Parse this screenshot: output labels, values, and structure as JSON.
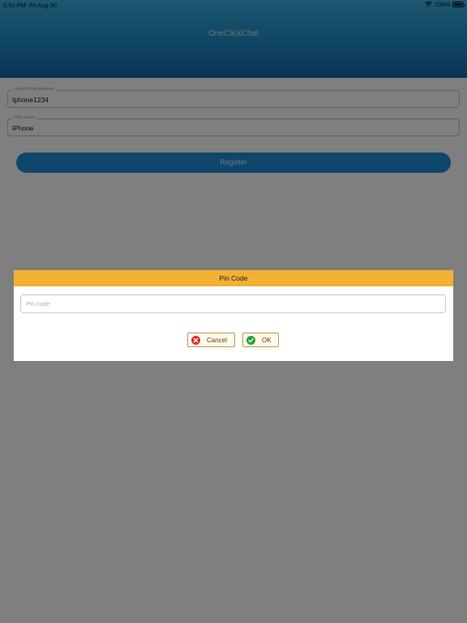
{
  "status_bar": {
    "time": "5:52 PM",
    "date": "Fri Aug 30",
    "battery": "100%",
    "icons": [
      "wifi-icon",
      "battery-icon"
    ]
  },
  "header": {
    "title": "OneClickChat"
  },
  "form": {
    "user_id": {
      "label": "UserID/mail address",
      "value": "Iphone1234"
    },
    "name": {
      "label": "Your name",
      "value": "iPhone"
    },
    "register_label": "Register"
  },
  "dialog": {
    "title": "Pin Code",
    "pin_placeholder": "Pin code",
    "pin_value": "",
    "cancel_label": "Cancel",
    "ok_label": "OK",
    "icons": [
      "cancel-x-icon",
      "ok-check-icon"
    ]
  },
  "colors": {
    "header_top": "#3aaee0",
    "header_bottom": "#1769a8",
    "register_button": "#1f8cd8",
    "dialog_header": "#f2b035",
    "cancel_icon": "#e0282a",
    "ok_icon": "#27a23a"
  }
}
